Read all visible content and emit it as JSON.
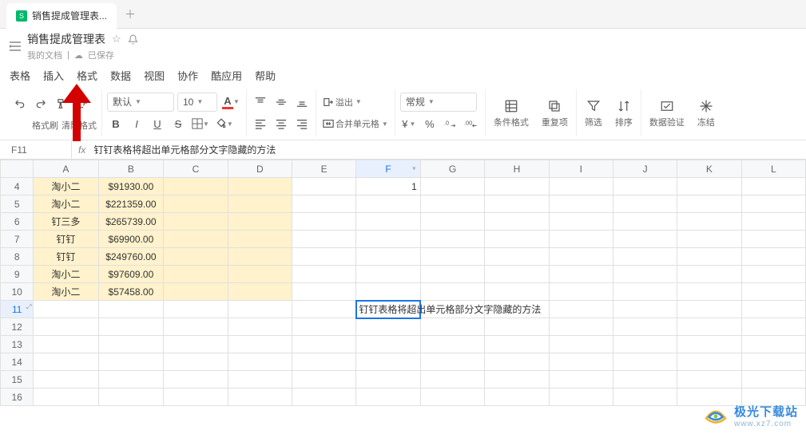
{
  "tab": {
    "name": "销售提成管理表..."
  },
  "title": {
    "name": "销售提成管理表",
    "location": "我的文档",
    "saved": "已保存"
  },
  "menu": [
    "表格",
    "插入",
    "格式",
    "数据",
    "视图",
    "协作",
    "酷应用",
    "帮助"
  ],
  "toolbar": {
    "format_brush": "格式刷",
    "clear_format": "清除格式",
    "font_name": "默认",
    "font_size": "10",
    "overflow_label": "溢出",
    "merge_label": "合并单元格",
    "number_format": "常规",
    "cond_format": "条件格式",
    "dup": "重复项",
    "filter": "筛选",
    "sort": "排序",
    "validation": "数据验证",
    "freeze": "冻结"
  },
  "formula_bar": {
    "cell_ref": "F11",
    "content": "钉钉表格将超出单元格部分文字隐藏的方法"
  },
  "columns": [
    "A",
    "B",
    "C",
    "D",
    "E",
    "F",
    "G",
    "H",
    "I",
    "J",
    "K",
    "L"
  ],
  "rows": [
    {
      "n": 4,
      "a": "淘小二",
      "b": "$91930.00"
    },
    {
      "n": 5,
      "a": "淘小二",
      "b": "$221359.00"
    },
    {
      "n": 6,
      "a": "钉三多",
      "b": "$265739.00"
    },
    {
      "n": 7,
      "a": "钉钉",
      "b": "$69900.00"
    },
    {
      "n": 8,
      "a": "钉钉",
      "b": "$249760.00"
    },
    {
      "n": 9,
      "a": "淘小二",
      "b": "$97609.00"
    },
    {
      "n": 10,
      "a": "淘小二",
      "b": "$57458.00"
    },
    {
      "n": 11
    },
    {
      "n": 12
    },
    {
      "n": 13
    },
    {
      "n": 14
    },
    {
      "n": 15
    },
    {
      "n": 16
    }
  ],
  "f4_value": "1",
  "f11_text": "钉钉表格将超出单元格部分文字隐藏的方法",
  "watermark": {
    "main": "极光下载站",
    "sub": "www.xz7.com"
  }
}
